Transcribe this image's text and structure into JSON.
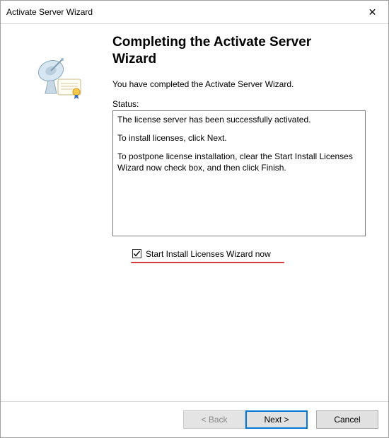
{
  "window": {
    "title": "Activate Server Wizard"
  },
  "icons": {
    "close": "✕"
  },
  "heading": "Completing the Activate Server Wizard",
  "body_text": "You have completed the Activate Server Wizard.",
  "status_label": "Status:",
  "status_lines": {
    "l1": "The license server has been successfully activated.",
    "l2": "To install licenses, click Next.",
    "l3": "To postpone license installation, clear the Start Install Licenses Wizard now check box, and then click Finish."
  },
  "checkbox": {
    "checked": true,
    "label": "Start Install Licenses Wizard now"
  },
  "buttons": {
    "back": "< Back",
    "next": "Next >",
    "cancel": "Cancel"
  }
}
